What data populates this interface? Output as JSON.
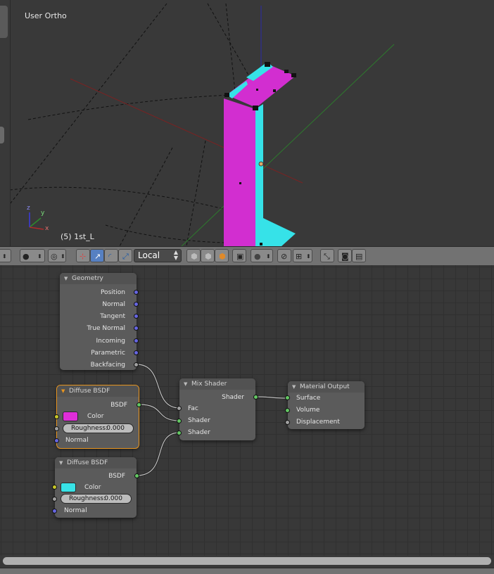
{
  "viewport": {
    "view_name": "User Ortho",
    "object_label": "(5) 1st_L",
    "axis_labels": {
      "x": "x",
      "y": "y",
      "z": "z"
    },
    "colors": {
      "magenta": "#d22ed0",
      "cyan": "#36e2e8",
      "x_axis": "#7a2222",
      "y_axis": "#2d7a2d",
      "z_axis": "#2a2aa8"
    }
  },
  "header": {
    "shading_icon": "viewport-shading-icon",
    "pivot_icon": "pivot-point-icon",
    "manipulator_icons": [
      "translate-manipulator-icon",
      "rotate-manipulator-icon",
      "scale-manipulator-icon"
    ],
    "orientation": "Local",
    "layer_icons": [
      "layer-1-icon",
      "layer-2-icon",
      "layer-3-icon"
    ],
    "snap_icon": "snap-magnet-icon",
    "render_icons": [
      "opengl-render-icon",
      "render-animation-icon"
    ]
  },
  "nodes": {
    "geometry": {
      "title": "Geometry",
      "outputs": [
        "Position",
        "Normal",
        "Tangent",
        "True Normal",
        "Incoming",
        "Parametric",
        "Backfacing"
      ]
    },
    "diffuse1": {
      "title": "Diffuse BSDF",
      "output": "BSDF",
      "color_label": "Color",
      "color": "#e02ed8",
      "roughness_label": "Roughness:",
      "roughness_value": "0.000",
      "normal_label": "Normal"
    },
    "diffuse2": {
      "title": "Diffuse BSDF",
      "output": "BSDF",
      "color_label": "Color",
      "color": "#38e2e6",
      "roughness_label": "Roughness:",
      "roughness_value": "0.000",
      "normal_label": "Normal"
    },
    "mix": {
      "title": "Mix Shader",
      "output": "Shader",
      "inputs": [
        "Fac",
        "Shader",
        "Shader"
      ]
    },
    "output": {
      "title": "Material Output",
      "inputs": [
        "Surface",
        "Volume",
        "Displacement"
      ]
    }
  },
  "socket_colors": {
    "vector": "#6666e0",
    "float": "#a1a1a1",
    "shader": "#63c763",
    "color": "#c7c729"
  }
}
